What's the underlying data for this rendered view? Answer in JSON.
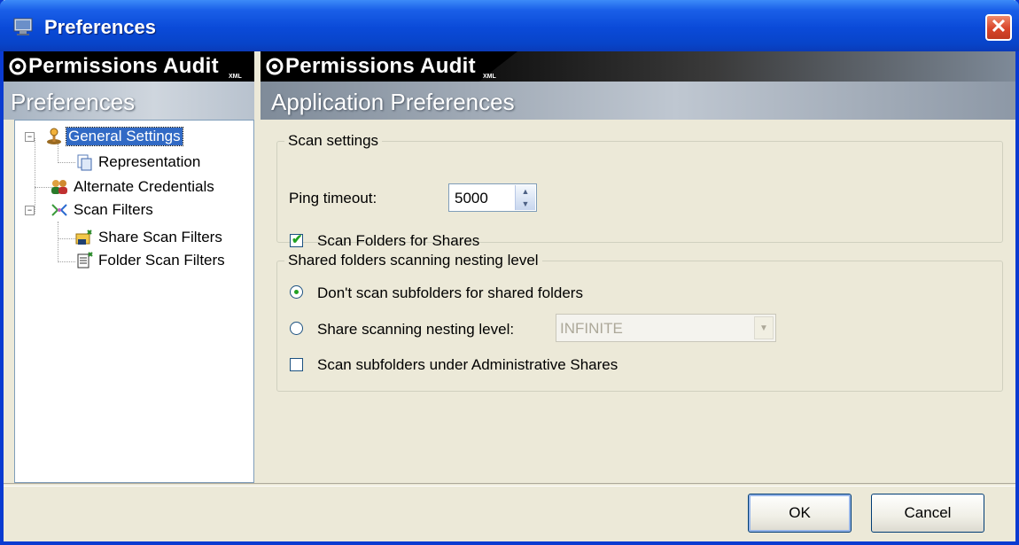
{
  "window": {
    "title": "Preferences"
  },
  "brand": {
    "name": "Permissions Audit",
    "suffix": "XML"
  },
  "left_panel": {
    "header": "Preferences"
  },
  "right_panel": {
    "header": "Application Preferences"
  },
  "tree": {
    "items": [
      {
        "label": "General Settings",
        "selected": true,
        "icon": "joystick-icon",
        "expander": "−"
      },
      {
        "label": "Representation",
        "selected": false,
        "icon": "document-icon"
      },
      {
        "label": "Alternate Credentials",
        "selected": false,
        "icon": "users-icon"
      },
      {
        "label": "Scan Filters",
        "selected": false,
        "icon": "filter-icon",
        "expander": "−"
      },
      {
        "label": "Share Scan Filters",
        "selected": false,
        "icon": "share-filter-icon"
      },
      {
        "label": "Folder Scan Filters",
        "selected": false,
        "icon": "folder-filter-icon"
      }
    ]
  },
  "scan_settings": {
    "legend": "Scan settings",
    "ping_label": "Ping timeout:",
    "ping_value": "5000",
    "scan_folders_label": "Scan Folders for Shares",
    "scan_folders_checked": true
  },
  "nesting": {
    "legend": "Shared folders scanning nesting level",
    "option1_label": "Don't scan subfolders for shared folders",
    "option1_selected": true,
    "option2_label": "Share scanning nesting level:",
    "option2_selected": false,
    "nesting_value": "INFINITE",
    "admin_shares_label": "Scan subfolders under Administrative Shares",
    "admin_shares_checked": false
  },
  "buttons": {
    "ok": "OK",
    "cancel": "Cancel"
  },
  "colors": {
    "titlebar": "#0a4ad8",
    "selection": "#316ac5",
    "check": "#21a121"
  }
}
